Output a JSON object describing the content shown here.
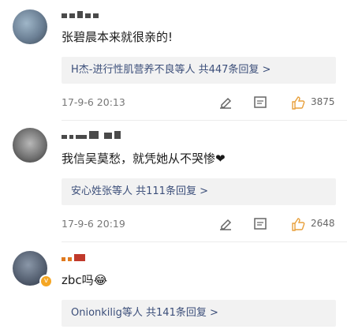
{
  "comments": [
    {
      "text": "张碧晨本来就很亲的!",
      "replies": "H杰-进行性肌营养不良等人 共447条回复 >",
      "time": "17-9-6 20:13",
      "likes": "3875"
    },
    {
      "text": "我信吴莫愁，就凭她从不哭惨❤",
      "replies": "安心姓张等人 共111条回复 >",
      "time": "17-9-6 20:19",
      "likes": "2648"
    },
    {
      "text": "zbc吗😂",
      "replies": "Onionkilig等人 共141条回复 >"
    }
  ],
  "icons": [
    "avatar",
    "verified-badge",
    "edit-icon",
    "comment-icon",
    "like-icon",
    "chevron-right-icon"
  ],
  "colors": {
    "reply_link": "#3c4f7a",
    "badge": "#f5a623",
    "reply_bg": "#f2f2f2"
  }
}
